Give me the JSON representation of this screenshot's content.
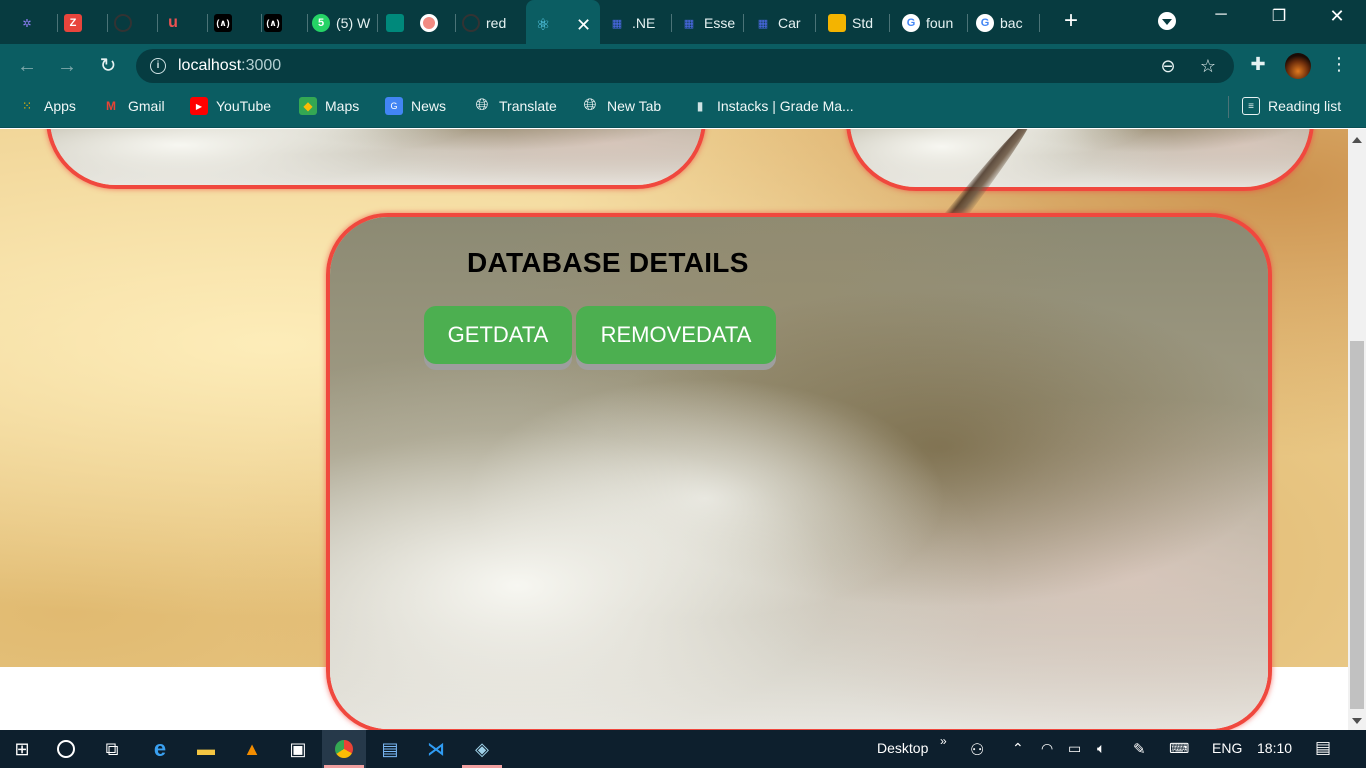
{
  "tabs": [
    {
      "label": "",
      "icon": "neural-logo-icon"
    },
    {
      "label": "",
      "icon": "zoho-icon"
    },
    {
      "label": "",
      "icon": "github-icon"
    },
    {
      "label": "",
      "icon": "udemy-icon"
    },
    {
      "label": "",
      "icon": "codepen-icon"
    },
    {
      "label": "",
      "icon": "codepen-icon"
    },
    {
      "label": "(5) W",
      "icon": "whatsapp-icon"
    },
    {
      "label": "",
      "icon": "meet-icon"
    },
    {
      "label": "",
      "icon": "record-icon"
    },
    {
      "label": "red",
      "icon": "github-icon"
    },
    {
      "label": "",
      "icon": "react-icon",
      "active": true
    },
    {
      "label": ".NE",
      "icon": "dev-grid-icon"
    },
    {
      "label": "Esse",
      "icon": "dev-grid-icon"
    },
    {
      "label": "Car",
      "icon": "dev-grid-icon"
    },
    {
      "label": "Std",
      "icon": "slides-icon"
    },
    {
      "label": "foun",
      "icon": "google-icon"
    },
    {
      "label": "bac",
      "icon": "google-icon"
    }
  ],
  "address": {
    "host": "localhost",
    "port": ":3000"
  },
  "bookmarks": [
    {
      "label": "Apps",
      "icon": "apps-grid-icon"
    },
    {
      "label": "Gmail",
      "icon": "gmail-icon"
    },
    {
      "label": "YouTube",
      "icon": "youtube-icon"
    },
    {
      "label": "Maps",
      "icon": "maps-icon"
    },
    {
      "label": "News",
      "icon": "news-icon"
    },
    {
      "label": "Translate",
      "icon": "globe-icon"
    },
    {
      "label": "New Tab",
      "icon": "globe-icon"
    },
    {
      "label": "Instacks | Grade Ma...",
      "icon": "doc-icon"
    }
  ],
  "reading_list": "Reading list",
  "page": {
    "title": "DATABASE DETAILS",
    "get_button": "GETDATA",
    "remove_button": "REMOVEDATA"
  },
  "taskbar": {
    "desktop_label": "Desktop",
    "language": "ENG",
    "time": "18:10"
  },
  "colors": {
    "chrome_dark": "#073b40",
    "chrome_teal": "#0b5d62",
    "card_border": "#f0483e",
    "button_green": "#4caf50"
  }
}
